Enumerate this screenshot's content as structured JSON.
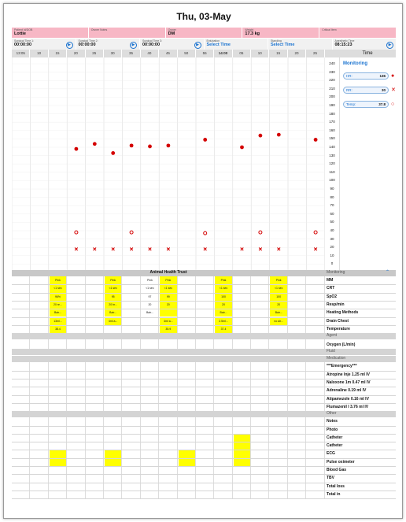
{
  "title": "Thu, 03-May",
  "header": {
    "row1": [
      {
        "label": "Patient Id/DOB",
        "value": "Lottie"
      },
      {
        "label": "Owner Notes",
        "value": ""
      },
      {
        "label": "Owner",
        "value": "DM"
      },
      {
        "label": "Weight",
        "value": "17.3 kg"
      },
      {
        "label": "Critical Item",
        "value": ""
      }
    ],
    "row2": [
      {
        "label": "Surgical Time 1:",
        "value": "00:00:00"
      },
      {
        "label": "Surgical Time 2:",
        "value": "00:00:00"
      },
      {
        "label": "Surgical Time 3:",
        "value": "00:00:00"
      },
      {
        "label": "Extubation",
        "value": "Select Time"
      },
      {
        "label": "Standing",
        "value": "Select Time"
      },
      {
        "label": "Anesthetic Time",
        "value": "08:15:23"
      }
    ]
  },
  "timeline": [
    "13:05",
    "10",
    "15",
    "20",
    "25",
    "30",
    "35",
    "40",
    "45",
    "50",
    "55",
    "14:00",
    "05",
    "10",
    "15",
    "20",
    "25"
  ],
  "time_header": "Time",
  "scale": [
    "240",
    "230",
    "220",
    "210",
    "200",
    "190",
    "180",
    "170",
    "160",
    "150",
    "140",
    "130",
    "120",
    "110",
    "100",
    "90",
    "80",
    "70",
    "60",
    "50",
    "40",
    "30",
    "20",
    "10",
    "0"
  ],
  "monitoring": {
    "title": "Monitoring",
    "items": [
      {
        "label": "HR:",
        "value": "136",
        "marker": "●"
      },
      {
        "label": "RR:",
        "value": "30",
        "marker": "✕"
      },
      {
        "label": "Temp:",
        "value": "37.8",
        "marker": "○"
      }
    ]
  },
  "chart_data": {
    "type": "scatter",
    "ylim": [
      0,
      240
    ],
    "series": [
      {
        "name": "HR",
        "points": [
          [
            3,
            138
          ],
          [
            4,
            144
          ],
          [
            5,
            133
          ],
          [
            6,
            142
          ],
          [
            7,
            141
          ],
          [
            8,
            142
          ],
          [
            10,
            149
          ],
          [
            12,
            140
          ],
          [
            13,
            154
          ],
          [
            14,
            155
          ],
          [
            16,
            149
          ]
        ]
      },
      {
        "name": "Temp",
        "points": [
          [
            3,
            38
          ],
          [
            6,
            38
          ],
          [
            10,
            37
          ],
          [
            13,
            38
          ],
          [
            16,
            38
          ]
        ]
      },
      {
        "name": "RR",
        "points": [
          [
            3,
            18
          ],
          [
            4,
            18
          ],
          [
            5,
            18
          ],
          [
            6,
            18
          ],
          [
            7,
            18
          ],
          [
            8,
            18
          ],
          [
            10,
            18
          ],
          [
            12,
            18
          ],
          [
            13,
            18
          ],
          [
            14,
            18
          ],
          [
            16,
            18
          ]
        ]
      }
    ]
  },
  "bands": {
    "aht": "Animal Health Trust",
    "monitoring": "Monitoring",
    "agent": "Agent",
    "fluid": "Fluid",
    "medication": "Medication",
    "other": "Other"
  },
  "monitor_rows": [
    "MM",
    "CRT",
    "SpO2",
    "Resp/min",
    "Heating Methods",
    "Drain Chest",
    "Temperature"
  ],
  "monitor_cells": [
    {
      "c": 2,
      "v": [
        "Pink",
        "<1 sec",
        "96%",
        "20 re...",
        "Bair...",
        "13ml...",
        "38.4"
      ],
      "y": true
    },
    {
      "c": 5,
      "v": [
        "Pink",
        "<1 sec",
        "95",
        "20 br...",
        "Bair...",
        "4ml a...",
        ""
      ],
      "y": true
    },
    {
      "c": 7,
      "v": [
        "Pink",
        "<1 sec",
        "97",
        "20",
        "Bair...",
        "",
        ""
      ],
      "y": false
    },
    {
      "c": 8,
      "v": [
        "Pink",
        "<1 sec",
        "99",
        "20",
        "",
        "4ml a...",
        "35.9"
      ],
      "y": true
    },
    {
      "c": 11,
      "v": [
        "Pink",
        "<1 sec",
        "100",
        "20",
        "Bair...",
        "2.5ml...",
        "37.4"
      ],
      "y": true
    },
    {
      "c": 14,
      "v": [
        "Pink",
        "<1 sec",
        "100",
        "20",
        "Bair...",
        "no air...",
        ""
      ],
      "y": true
    }
  ],
  "agent_rows": [
    "Oxygen (L/min)"
  ],
  "medication_rows": [
    "***Emergency***",
    "Atropine Inje 1.25 ml IV",
    "Naloxone 1m 0.47 ml IV",
    "Adrenaline 0.19 ml IV",
    "Atipamezole 0.16 ml IV",
    "Flumazenil I 3.76 ml IV"
  ],
  "other_rows": [
    "Notes",
    "Photo",
    "Catheter",
    "Catheter",
    "ECG",
    "Pulse oximeter",
    "Blood Gas",
    "TBV",
    "Total loss",
    "Total in"
  ],
  "colors": {
    "pink": "#f7b7c5",
    "accent": "#1a73d0",
    "highlight": "#ffff00",
    "marker": "#d40000"
  }
}
